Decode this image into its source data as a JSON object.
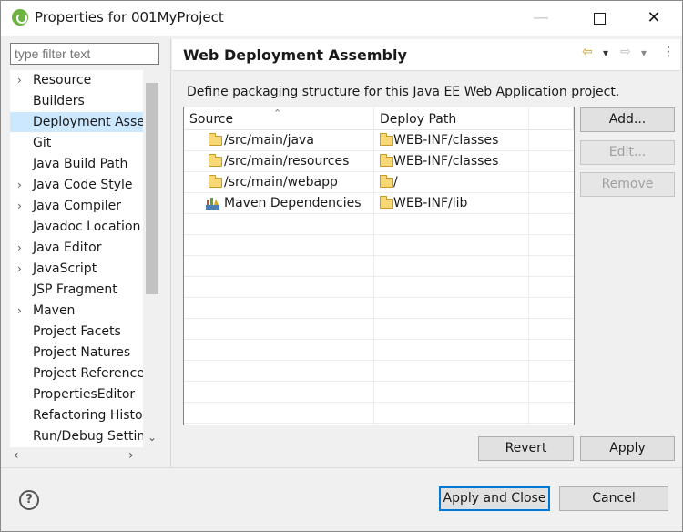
{
  "window": {
    "title": "Properties for 001MyProject",
    "minimize": "—",
    "close": "✕"
  },
  "filter": {
    "placeholder": "type filter text"
  },
  "tree": {
    "items": [
      {
        "label": "Resource",
        "expandable": true
      },
      {
        "label": "Builders",
        "expandable": false
      },
      {
        "label": "Deployment Assembly",
        "expandable": false,
        "selected": true
      },
      {
        "label": "Git",
        "expandable": false
      },
      {
        "label": "Java Build Path",
        "expandable": false
      },
      {
        "label": "Java Code Style",
        "expandable": true
      },
      {
        "label": "Java Compiler",
        "expandable": true
      },
      {
        "label": "Javadoc Location",
        "expandable": false
      },
      {
        "label": "Java Editor",
        "expandable": true
      },
      {
        "label": "JavaScript",
        "expandable": true
      },
      {
        "label": "JSP Fragment",
        "expandable": false
      },
      {
        "label": "Maven",
        "expandable": true
      },
      {
        "label": "Project Facets",
        "expandable": false
      },
      {
        "label": "Project Natures",
        "expandable": false
      },
      {
        "label": "Project References",
        "expandable": false
      },
      {
        "label": "PropertiesEditor",
        "expandable": false
      },
      {
        "label": "Refactoring History",
        "expandable": false
      },
      {
        "label": "Run/Debug Settings",
        "expandable": false
      }
    ],
    "chevron": "›",
    "scroll_down": "⌄",
    "scroll_left": "‹",
    "scroll_right": "›"
  },
  "page": {
    "title": "Web Deployment Assembly",
    "description": "Define packaging structure for this Java EE Web Application project.",
    "nav_back": "⇦",
    "nav_back_menu": "▾",
    "nav_forward": "⇨",
    "nav_forward_menu": "▾",
    "view_menu": "⋮"
  },
  "table": {
    "columns": [
      "Source",
      "Deploy Path"
    ],
    "sort_indicator": "⌃",
    "rows": [
      {
        "source": "/src/main/java",
        "deploy": "WEB-INF/classes",
        "icon": "folder-icon"
      },
      {
        "source": "/src/main/resources",
        "deploy": "WEB-INF/classes",
        "icon": "folder-icon"
      },
      {
        "source": "/src/main/webapp",
        "deploy": "/",
        "icon": "folder-icon"
      },
      {
        "source": "Maven Dependencies",
        "deploy": "WEB-INF/lib",
        "icon": "library-icon"
      }
    ]
  },
  "buttons": {
    "add": "Add...",
    "edit": "Edit...",
    "remove": "Remove",
    "revert": "Revert",
    "apply": "Apply",
    "apply_close": "Apply and Close",
    "cancel": "Cancel",
    "help": "?"
  },
  "colors": {
    "selection": "#cce8ff",
    "default_button_border": "#0078d7",
    "folder": "#f8d775"
  }
}
